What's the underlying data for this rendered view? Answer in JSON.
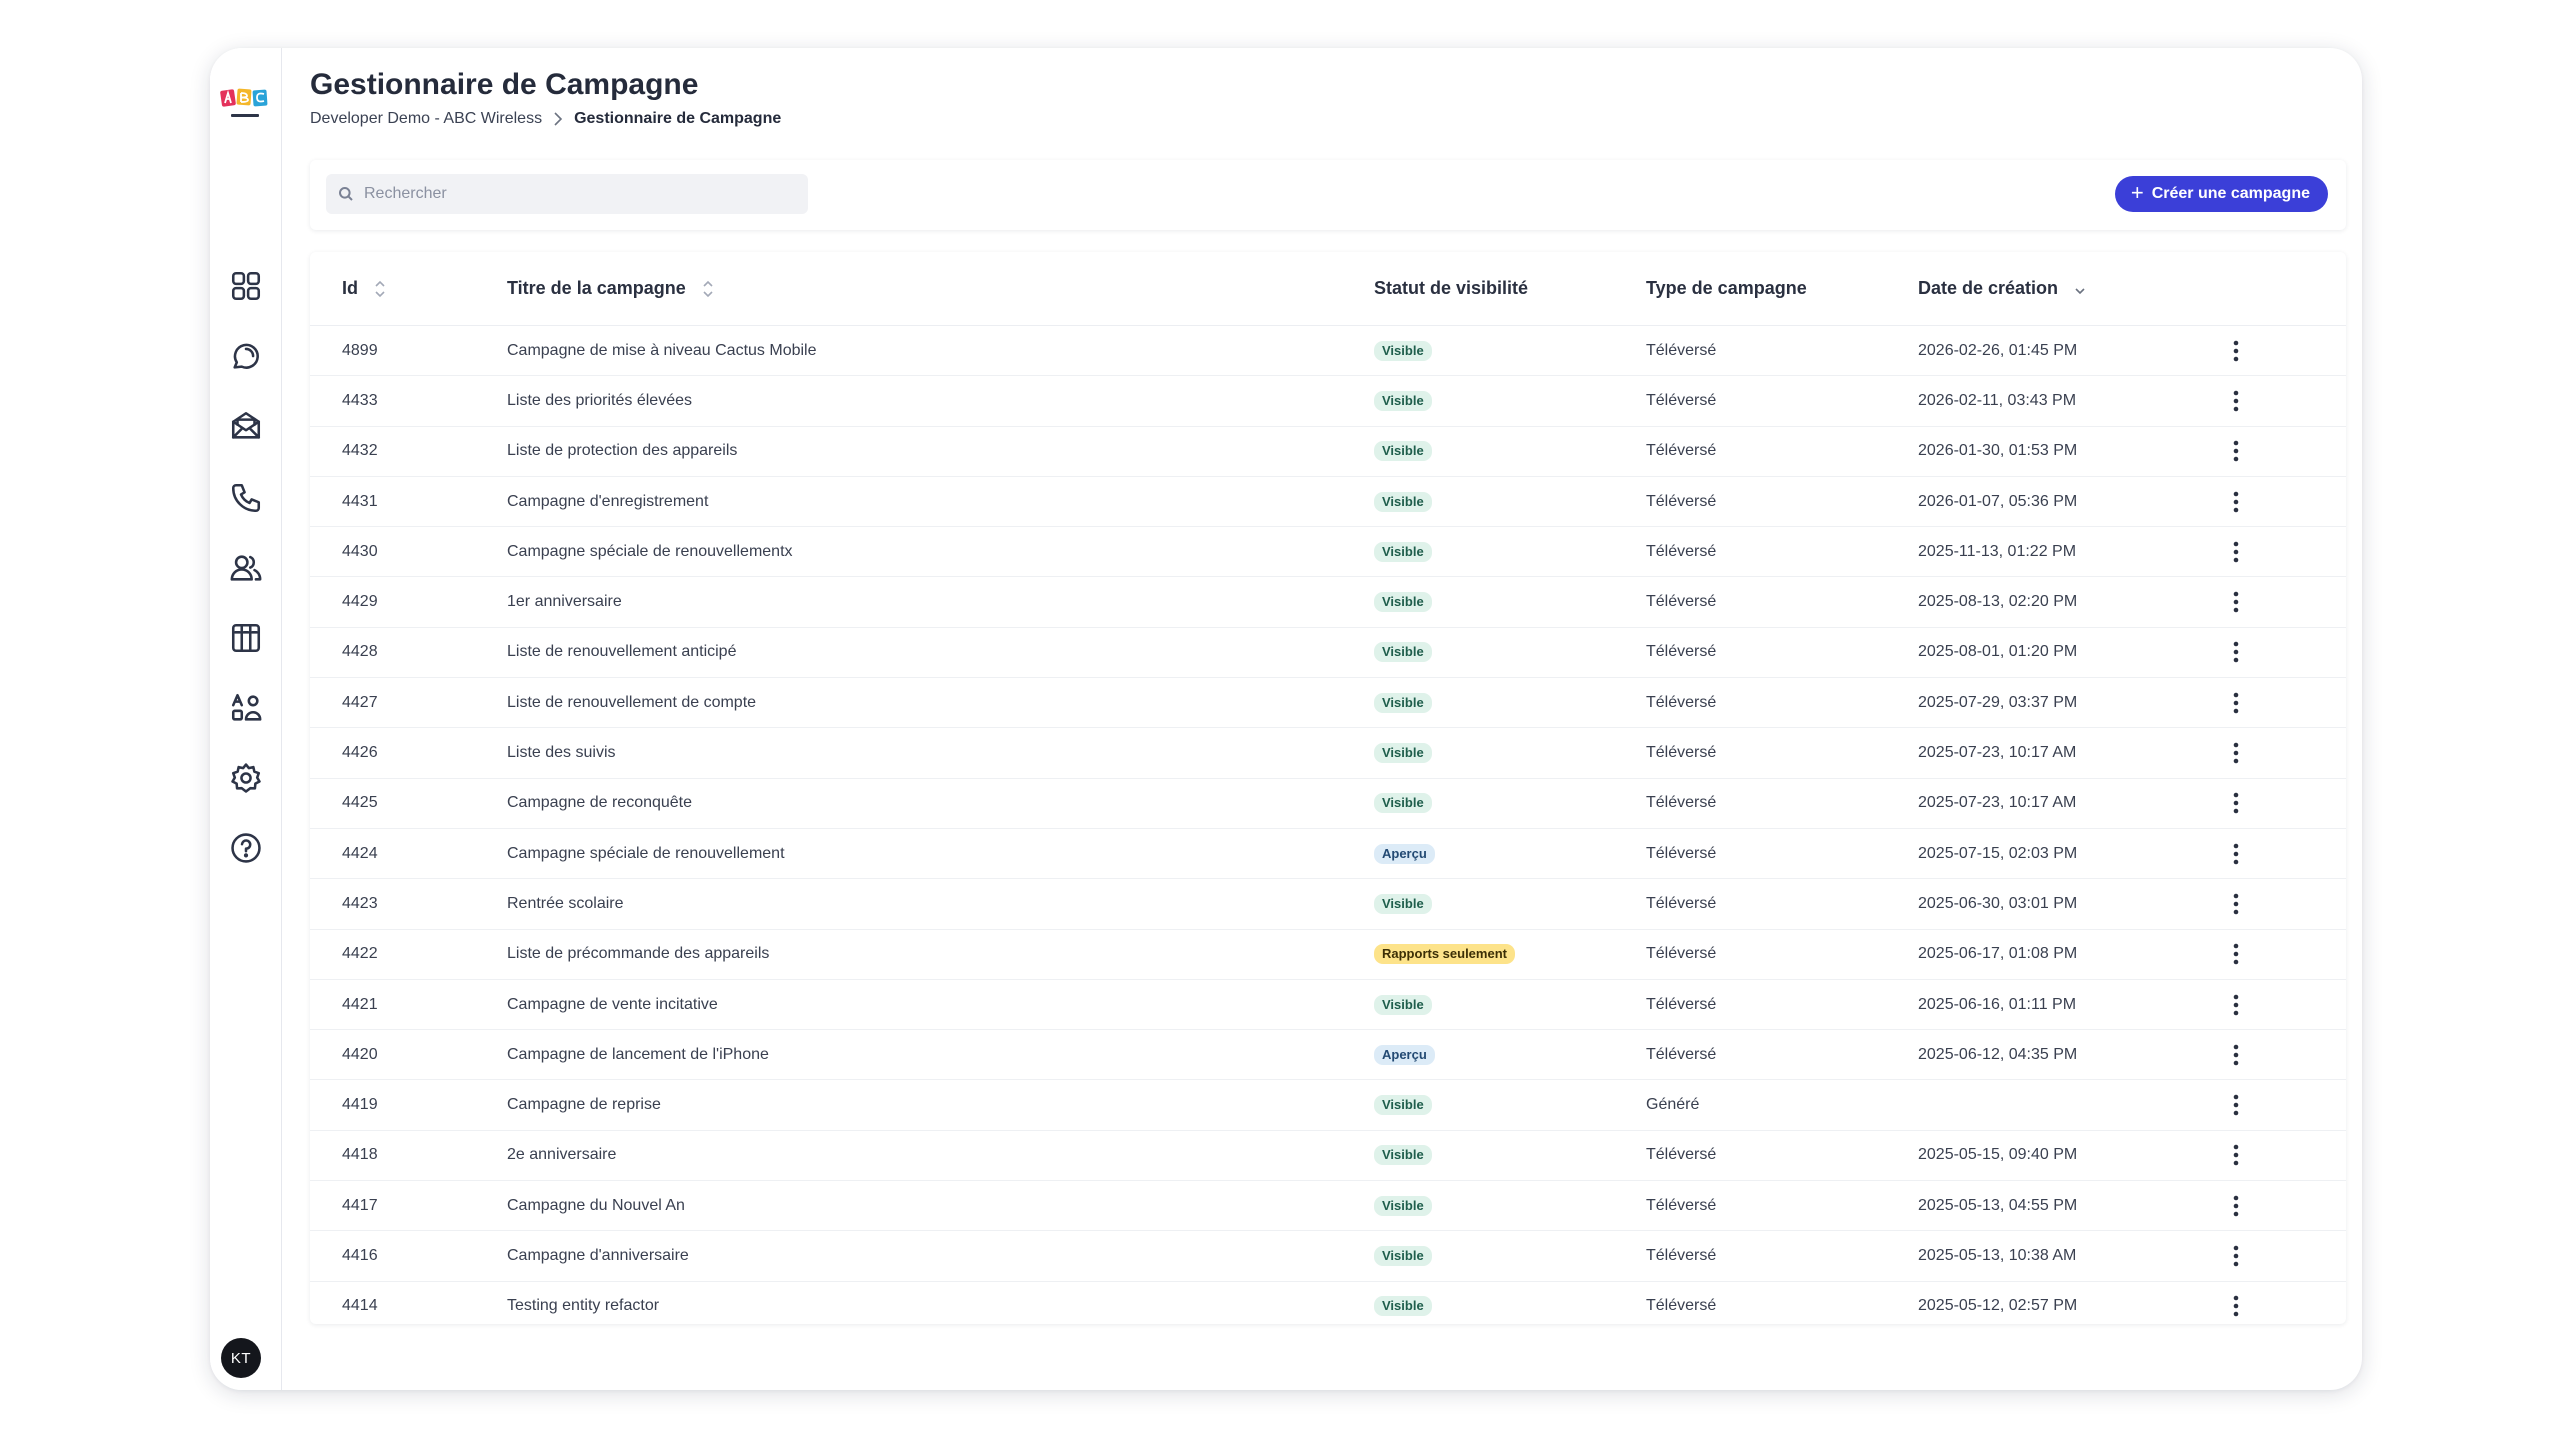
{
  "app": {
    "logo_icon": "abc-logo-icon",
    "colors": {
      "accent": "#3b3fd8",
      "visible": "#dff2ea",
      "apercu": "#dcebf7",
      "rapports": "#fde38a"
    }
  },
  "sidebar": {
    "items": [
      {
        "name": "dashboard",
        "icon": "grid-icon"
      },
      {
        "name": "conversations",
        "icon": "chat-bubble-icon"
      },
      {
        "name": "campaigns",
        "icon": "mail-icon"
      },
      {
        "name": "calls",
        "icon": "phone-icon"
      },
      {
        "name": "contacts",
        "icon": "users-icon"
      },
      {
        "name": "library",
        "icon": "books-icon"
      },
      {
        "name": "teams",
        "icon": "team-icon"
      },
      {
        "name": "settings",
        "icon": "gear-icon"
      },
      {
        "name": "help",
        "icon": "help-icon"
      }
    ],
    "avatar_initials": "KT"
  },
  "header": {
    "title": "Gestionnaire de Campagne",
    "breadcrumb": [
      "Developer Demo - ABC Wireless",
      "Gestionnaire de Campagne"
    ]
  },
  "toolbar": {
    "search_placeholder": "Rechercher",
    "search_value": "",
    "create_label": "Créer une campagne"
  },
  "table": {
    "columns": {
      "id": "Id",
      "title": "Titre de la campagne",
      "status": "Statut de visibilité",
      "type": "Type de campagne",
      "date": "Date de création"
    },
    "rows": [
      {
        "id": "4899",
        "title": "Campagne de mise à niveau Cactus Mobile",
        "status": "Visible",
        "status_kind": "visible",
        "type": "Téléversé",
        "date": "2026-02-26, 01:45 PM"
      },
      {
        "id": "4433",
        "title": "Liste des priorités élevées",
        "status": "Visible",
        "status_kind": "visible",
        "type": "Téléversé",
        "date": "2026-02-11, 03:43 PM"
      },
      {
        "id": "4432",
        "title": "Liste de protection des appareils",
        "status": "Visible",
        "status_kind": "visible",
        "type": "Téléversé",
        "date": "2026-01-30, 01:53 PM"
      },
      {
        "id": "4431",
        "title": "Campagne d'enregistrement",
        "status": "Visible",
        "status_kind": "visible",
        "type": "Téléversé",
        "date": "2026-01-07, 05:36 PM"
      },
      {
        "id": "4430",
        "title": "Campagne spéciale de renouvellementx",
        "status": "Visible",
        "status_kind": "visible",
        "type": "Téléversé",
        "date": "2025-11-13, 01:22 PM"
      },
      {
        "id": "4429",
        "title": "1er anniversaire",
        "status": "Visible",
        "status_kind": "visible",
        "type": "Téléversé",
        "date": "2025-08-13, 02:20 PM"
      },
      {
        "id": "4428",
        "title": "Liste de renouvellement anticipé",
        "status": "Visible",
        "status_kind": "visible",
        "type": "Téléversé",
        "date": "2025-08-01, 01:20 PM"
      },
      {
        "id": "4427",
        "title": "Liste de renouvellement de compte",
        "status": "Visible",
        "status_kind": "visible",
        "type": "Téléversé",
        "date": "2025-07-29, 03:37 PM"
      },
      {
        "id": "4426",
        "title": "Liste des suivis",
        "status": "Visible",
        "status_kind": "visible",
        "type": "Téléversé",
        "date": "2025-07-23, 10:17 AM"
      },
      {
        "id": "4425",
        "title": "Campagne de reconquête",
        "status": "Visible",
        "status_kind": "visible",
        "type": "Téléversé",
        "date": "2025-07-23, 10:17 AM"
      },
      {
        "id": "4424",
        "title": "Campagne spéciale de renouvellement",
        "status": "Aperçu",
        "status_kind": "apercu",
        "type": "Téléversé",
        "date": "2025-07-15, 02:03 PM"
      },
      {
        "id": "4423",
        "title": "Rentrée scolaire",
        "status": "Visible",
        "status_kind": "visible",
        "type": "Téléversé",
        "date": "2025-06-30, 03:01 PM"
      },
      {
        "id": "4422",
        "title": "Liste de précommande des appareils",
        "status": "Rapports seulement",
        "status_kind": "rapports",
        "type": "Téléversé",
        "date": "2025-06-17, 01:08 PM"
      },
      {
        "id": "4421",
        "title": "Campagne de vente incitative",
        "status": "Visible",
        "status_kind": "visible",
        "type": "Téléversé",
        "date": "2025-06-16, 01:11 PM"
      },
      {
        "id": "4420",
        "title": "Campagne de lancement de l'iPhone",
        "status": "Aperçu",
        "status_kind": "apercu",
        "type": "Téléversé",
        "date": "2025-06-12, 04:35 PM"
      },
      {
        "id": "4419",
        "title": "Campagne de reprise",
        "status": "Visible",
        "status_kind": "visible",
        "type": "Généré",
        "date": ""
      },
      {
        "id": "4418",
        "title": "2e anniversaire",
        "status": "Visible",
        "status_kind": "visible",
        "type": "Téléversé",
        "date": "2025-05-15, 09:40 PM"
      },
      {
        "id": "4417",
        "title": "Campagne du Nouvel An",
        "status": "Visible",
        "status_kind": "visible",
        "type": "Téléversé",
        "date": "2025-05-13, 04:55 PM"
      },
      {
        "id": "4416",
        "title": "Campagne d'anniversaire",
        "status": "Visible",
        "status_kind": "visible",
        "type": "Téléversé",
        "date": "2025-05-13, 10:38 AM"
      },
      {
        "id": "4414",
        "title": "Testing entity refactor",
        "status": "Visible",
        "status_kind": "visible",
        "type": "Téléversé",
        "date": "2025-05-12, 02:57 PM"
      }
    ]
  }
}
